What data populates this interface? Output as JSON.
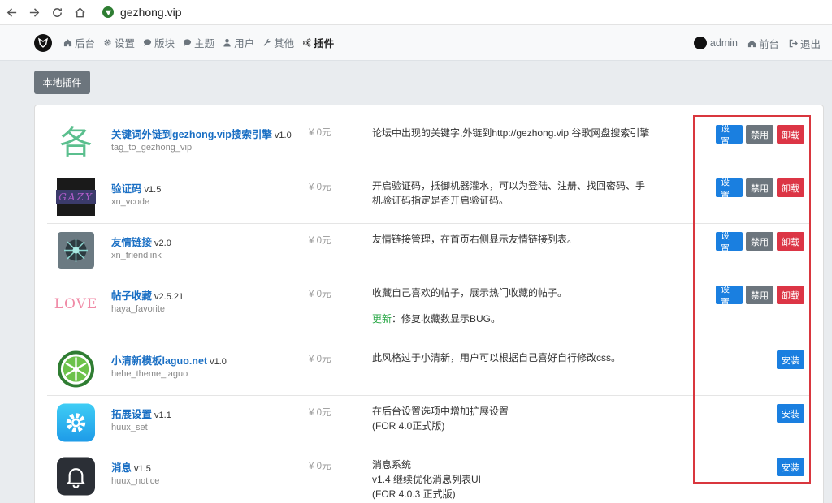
{
  "browser": {
    "url": "gezhong.vip"
  },
  "header": {
    "menu": [
      {
        "id": "admin",
        "label": "后台",
        "icon": "home-icon"
      },
      {
        "id": "settings",
        "label": "设置",
        "icon": "gear-icon"
      },
      {
        "id": "forums",
        "label": "版块",
        "icon": "comment-icon"
      },
      {
        "id": "threads",
        "label": "主题",
        "icon": "comments-icon"
      },
      {
        "id": "users",
        "label": "用户",
        "icon": "user-icon"
      },
      {
        "id": "other",
        "label": "其他",
        "icon": "wrench-icon"
      },
      {
        "id": "plugins",
        "label": "插件",
        "icon": "cogs-icon"
      }
    ],
    "user": "admin",
    "front": "前台",
    "logout": "退出"
  },
  "page": {
    "local_plugins_button": "本地插件"
  },
  "buttons": {
    "settings": "设置",
    "disable": "禁用",
    "uninstall": "卸载",
    "install": "安装"
  },
  "plugins": [
    {
      "name": "关键词外链到gezhong.vip搜索引擎",
      "version": "v1.0",
      "dir": "tag_to_gezhong_vip",
      "price": "¥ 0元",
      "desc": "论坛中出现的关键字,外链到http://gezhong.vip 谷歌网盘搜索引擎",
      "installed": true,
      "thumb_text": "各"
    },
    {
      "name": "验证码",
      "version": "v1.5",
      "dir": "xn_vcode",
      "price": "¥ 0元",
      "desc": "开启验证码，抵御机器灌水，可以为登陆、注册、找回密码、手机验证码指定是否开启验证码。",
      "installed": true,
      "thumb_text": "GAZY"
    },
    {
      "name": "友情链接",
      "version": "v2.0",
      "dir": "xn_friendlink",
      "price": "¥ 0元",
      "desc": "友情链接管理，在首页右侧显示友情链接列表。",
      "installed": true
    },
    {
      "name": "帖子收藏",
      "version": "v2.5.21",
      "dir": "haya_favorite",
      "price": "¥ 0元",
      "desc": "收藏自己喜欢的帖子，展示热门收藏的帖子。",
      "update_label": "更新",
      "update_text": "：修复收藏数显示BUG。",
      "installed": true,
      "thumb_text": "LOVE"
    },
    {
      "name": "小清新模板laguo.net",
      "version": "v1.0",
      "dir": "hehe_theme_laguo",
      "price": "¥ 0元",
      "desc": "此风格过于小清新，用户可以根据自己喜好自行修改css。",
      "installed": false
    },
    {
      "name": "拓展设置",
      "version": "v1.1",
      "dir": "huux_set",
      "price": "¥ 0元",
      "desc_lines": [
        "在后台设置选项中增加扩展设置",
        "(FOR 4.0正式版)"
      ],
      "installed": false
    },
    {
      "name": "消息",
      "version": "v1.5",
      "dir": "huux_notice",
      "price": "¥ 0元",
      "desc_lines": [
        "消息系统",
        "v1.4 继续优化消息列表UI",
        "(FOR 4.0.3 正式版)"
      ],
      "installed": false
    }
  ],
  "colors": {
    "link": "#1a6fc4",
    "primary": "#1a7fe0",
    "secondary": "#6c757d",
    "danger": "#dc3545",
    "success": "#28a745",
    "highlight": "#d9363e"
  }
}
